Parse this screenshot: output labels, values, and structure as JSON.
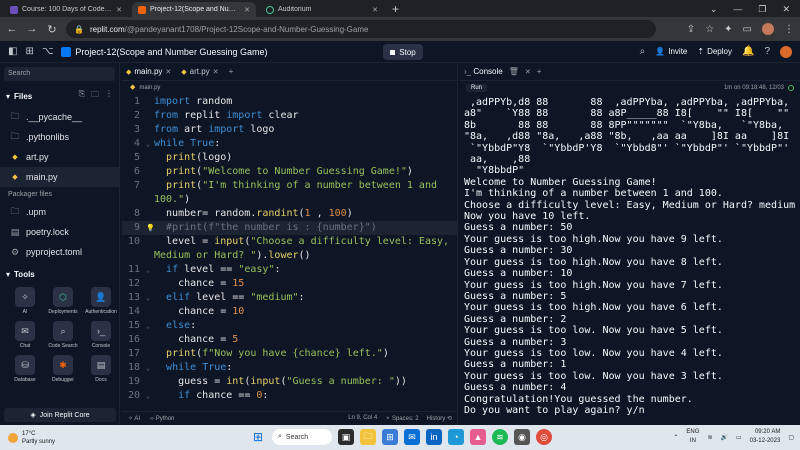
{
  "browser": {
    "tabs": [
      {
        "label": "Course: 100 Days of Code: The C",
        "color": "#6b4fbb"
      },
      {
        "label": "Project-12(Scope and Number G",
        "color": "#f26207"
      },
      {
        "label": "Auditorium",
        "color": "#202124"
      }
    ],
    "url_host": "replit.com",
    "url_path": "/@pandeyanant1708/Project-12Scope-and-Number-Guessing-Game"
  },
  "replit": {
    "project_name": "Project-12(Scope and Number Guessing Game)",
    "stop_label": "Stop",
    "invite_label": "Invite",
    "deploy_label": "Deploy"
  },
  "sidebar": {
    "search_placeholder": "Search",
    "files_heading": "Files",
    "files": [
      ".__pycache__",
      ".pythonlibs",
      "art.py",
      "main.py"
    ],
    "packager_heading": "Packager files",
    "packager_files": [
      ".upm",
      "poetry.lock",
      "pyproject.toml"
    ],
    "tools_heading": "Tools",
    "tools": [
      "AI",
      "Deployments",
      "Authentication",
      "Chat",
      "Code Search",
      "Console",
      "Database",
      "Debugger",
      "Docs"
    ],
    "join_label": "Join Replit Core"
  },
  "editor": {
    "tabs": [
      "main.py",
      "art.py"
    ],
    "breadcrumb": "main.py",
    "lines": [
      {
        "n": "1",
        "html": "<span class='kw'>import</span> random"
      },
      {
        "n": "2",
        "html": "<span class='kw'>from</span> replit <span class='kw'>import</span> clear"
      },
      {
        "n": "3",
        "html": "<span class='kw'>from</span> art <span class='kw'>import</span> logo"
      },
      {
        "n": "4",
        "html": "<span class='kw'>while</span> <span class='kw'>True</span>:",
        "fold": true
      },
      {
        "n": "5",
        "html": "  <span class='fn'>print</span>(logo)"
      },
      {
        "n": "6",
        "html": "  <span class='fn'>print</span>(<span class='str'>\"Welcome to Number Guessing Game!\"</span>)"
      },
      {
        "n": "7",
        "html": "  <span class='fn'>print</span>(<span class='str'>\"I'm thinking of a number between 1 and</span>"
      },
      {
        "n": "",
        "html": "<span class='str'>100.\"</span>)"
      },
      {
        "n": "8",
        "html": "  number= random.<span class='fn'>randint</span>(<span class='num'>1</span> , <span class='num'>100</span>)"
      },
      {
        "n": "9",
        "html": "  <span class='cmt'>#print(f\"the number is : {number}\")</span>",
        "hl": true
      },
      {
        "n": "10",
        "html": "  level = <span class='fn'>input</span>(<span class='str'>\"Choose a difficulty level: Easy,</span>"
      },
      {
        "n": "",
        "html": "<span class='str'>Medium or Hard? \"</span>).<span class='fn'>lower</span>()"
      },
      {
        "n": "11",
        "html": "  <span class='kw'>if</span> level == <span class='str'>\"easy\"</span>:",
        "fold": true
      },
      {
        "n": "12",
        "html": "    chance = <span class='num'>15</span>"
      },
      {
        "n": "13",
        "html": "  <span class='kw'>elif</span> level == <span class='str'>\"medium\"</span>:",
        "fold": true
      },
      {
        "n": "14",
        "html": "    chance = <span class='num'>10</span>"
      },
      {
        "n": "15",
        "html": "  <span class='kw'>else</span>:",
        "fold": true
      },
      {
        "n": "16",
        "html": "    chance = <span class='num'>5</span>"
      },
      {
        "n": "17",
        "html": "  <span class='fn'>print</span>(<span class='str'>f\"Now you have {chance} left.\"</span>)"
      },
      {
        "n": "18",
        "html": "  <span class='kw'>while</span> <span class='kw'>True</span>:",
        "fold": true
      },
      {
        "n": "19",
        "html": "    guess = <span class='fn'>int</span>(<span class='fn'>input</span>(<span class='str'>\"Guess a number: \"</span>))"
      },
      {
        "n": "20",
        "html": "    <span class='kw'>if</span> chance == <span class='num'>0</span>:",
        "fold": true
      }
    ],
    "status_ai": "AI",
    "status_lang": "Python",
    "status_pos": "Ln 9, Col 4",
    "status_spaces": "Spaces: 2",
    "status_history": "History"
  },
  "console": {
    "tab_label": "Console",
    "run_label": "Run",
    "timestamp": "1m on 09:18:48, 12/03",
    "output": [
      " ,adPPYb,d8 88       88  ,adPPYba, ,adPPYba, ,adPPYba,",
      "a8\"    `Y88 88       88 a8P_____88 I8[    \"\" I8[    \"\"",
      "8b       88 88       88 8PP\"\"\"\"\"\"\"  `\"Y8ba,   `\"Y8ba,",
      "\"8a,   ,d88 \"8a,   ,a88 \"8b,   ,aa aa    ]8I aa    ]8I",
      " `\"YbbdP\"Y8  `\"YbbdP'Y8  `\"Ybbd8\"' `\"YbbdP\"' `\"YbbdP\"'",
      " aa,    ,88",
      "  \"Y8bbdP\"",
      "Welcome to Number Guessing Game!",
      "I'm thinking of a number between 1 and 100.",
      "Choose a difficulty level: Easy, Medium or Hard? medium",
      "Now you have 10 left.",
      "Guess a number: 50",
      "Your guess is too high.Now you have 9 left.",
      "Guess a number: 30",
      "Your guess is too high.Now you have 8 left.",
      "Guess a number: 10",
      "Your guess is too high.Now you have 7 left.",
      "Guess a number: 5",
      "Your guess is too high.Now you have 6 left.",
      "Guess a number: 2",
      "Your guess is too low. Now you have 5 left.",
      "Guess a number: 3",
      "Your guess is too low. Now you have 4 left.",
      "Guess a number: 1",
      "Your guess is too low. Now you have 3 left.",
      "Guess a number: 4",
      "Congratulation!You guessed the number.",
      "Do you want to play again? y/n "
    ]
  },
  "taskbar": {
    "temp": "17°C",
    "weather": "Partly sunny",
    "search_label": "Search",
    "lang1": "ENG",
    "lang2": "IN",
    "time": "09:20 AM",
    "date": "03-12-2023"
  }
}
